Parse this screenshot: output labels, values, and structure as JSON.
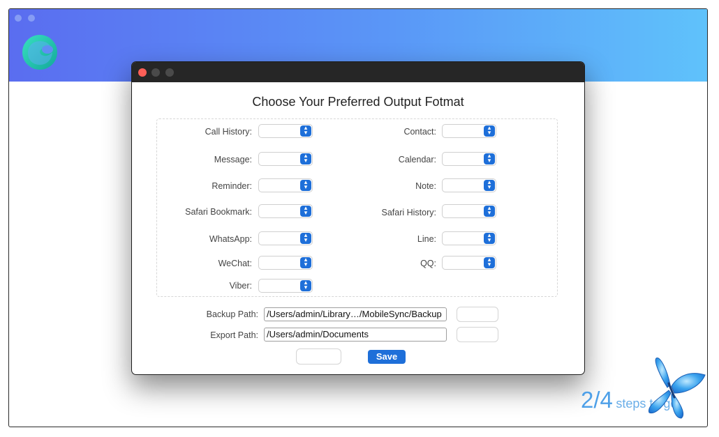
{
  "dialog": {
    "title": "Choose Your Preferred Output Fotmat",
    "formats": [
      {
        "label": "Call History:"
      },
      {
        "label": "Contact:"
      },
      {
        "label": "Message:"
      },
      {
        "label": "Calendar:"
      },
      {
        "label": "Reminder:"
      },
      {
        "label": "Note:"
      },
      {
        "label": "Safari Bookmark:"
      },
      {
        "label": "Safari History:"
      },
      {
        "label": "WhatsApp:"
      },
      {
        "label": "Line:"
      },
      {
        "label": "WeChat:"
      },
      {
        "label": "QQ:"
      },
      {
        "label": "Viber:"
      }
    ],
    "backup_path": {
      "label": "Backup Path:",
      "value": "/Users/admin/Library…/MobileSync/Backup"
    },
    "export_path": {
      "label": "Export Path:",
      "value": "/Users/admin/Documents"
    },
    "save_label": "Save"
  },
  "progress": {
    "current": "2/4",
    "suffix": "steps to go"
  },
  "colors": {
    "accent": "#1e6fd9",
    "header_start": "#5a6df0",
    "header_end": "#5fc2fb",
    "steps_text": "#4ea0e8"
  }
}
